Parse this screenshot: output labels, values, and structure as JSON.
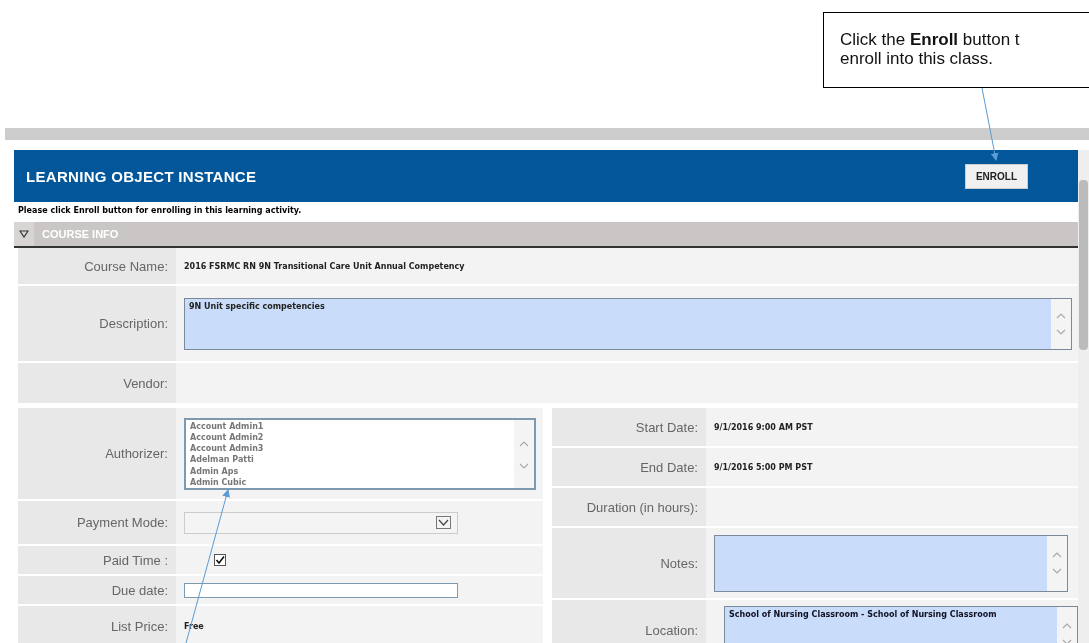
{
  "callout": {
    "lines": [
      "Click the **Enroll** button t",
      "enroll into this class."
    ]
  },
  "panel": {
    "title": "LEARNING OBJECT INSTANCE",
    "button": "ENROLL"
  },
  "notice": "Please click Enroll button for enrolling in this learning activity.",
  "section": {
    "title": "COURSE INFO",
    "expanded": true
  },
  "course_name": {
    "label": "Course Name:",
    "value": "2016 FSRMC RN 9N Transitional Care Unit Annual Competency"
  },
  "description": {
    "label": "Description:",
    "value": "9N Unit specific competencies"
  },
  "vendor": {
    "label": "Vendor:"
  },
  "authorizer": {
    "label": "Authorizer:",
    "options": [
      "Account Admin1",
      "Account Admin2",
      "Account Admin3",
      "Adelman Patti",
      "Admin Aps",
      "Admin Cubic"
    ]
  },
  "payment_mode": {
    "label": "Payment Mode:"
  },
  "paid_time": {
    "label": "Paid Time :",
    "checked": true
  },
  "due_date": {
    "label": "Due date:"
  },
  "list_price": {
    "label": "List Price:",
    "value": "Free"
  },
  "start_date": {
    "label": "Start Date:",
    "value": "9/1/2016 9:00 AM PST"
  },
  "end_date": {
    "label": "End Date:",
    "value": "9/1/2016 5:00 PM PST"
  },
  "duration": {
    "label": "Duration (in hours):"
  },
  "notes": {
    "label": "Notes:"
  },
  "location": {
    "label": "Location:",
    "value": "School of Nursing Classroom - School of Nursing Classroom"
  }
}
